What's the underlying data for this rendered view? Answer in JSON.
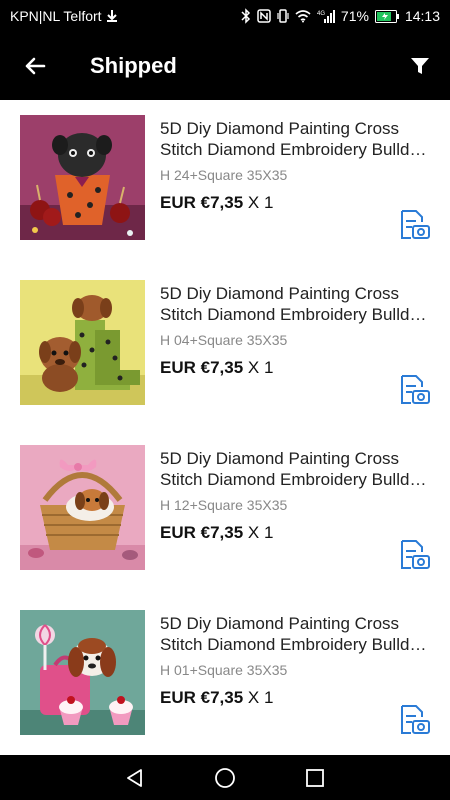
{
  "status_bar": {
    "carrier": "KPN|NL Telfort",
    "battery": "71%",
    "time": "14:13",
    "network": "4G"
  },
  "header": {
    "title": "Shipped"
  },
  "orders": [
    {
      "name": "5D Diy Diamond Painting Cross Stitch Diamond Embroidery Bulld…",
      "variant": "H 24+Square 35X35",
      "price_bold": "EUR €7,35",
      "qty": " X 1",
      "image": "pug-in-pot-painting"
    },
    {
      "name": "5D Diy Diamond Painting Cross Stitch Diamond Embroidery Bulld…",
      "variant": "H 04+Square 35X35",
      "price_bold": "EUR €7,35",
      "qty": " X 1",
      "image": "puppies-with-boots-painting"
    },
    {
      "name": "5D Diy Diamond Painting Cross Stitch Diamond Embroidery Bulld…",
      "variant": "H 12+Square 35X35",
      "price_bold": "EUR €7,35",
      "qty": " X 1",
      "image": "puppy-in-basket-painting"
    },
    {
      "name": "5D Diy Diamond Painting Cross Stitch Diamond Embroidery Bulld…",
      "variant": "H 01+Square 35X35",
      "price_bold": "EUR €7,35",
      "qty": " X 1",
      "image": "puppy-with-cupcakes-painting"
    }
  ],
  "icons": {
    "back": "arrow-left-icon",
    "filter": "filter-icon",
    "review": "photo-review-icon",
    "nav_back": "triangle-back-icon",
    "nav_home": "circle-home-icon",
    "nav_recent": "square-recent-icon"
  },
  "colors": {
    "bar": "#000000",
    "accent": "#2a7bd6",
    "muted": "#888888"
  }
}
